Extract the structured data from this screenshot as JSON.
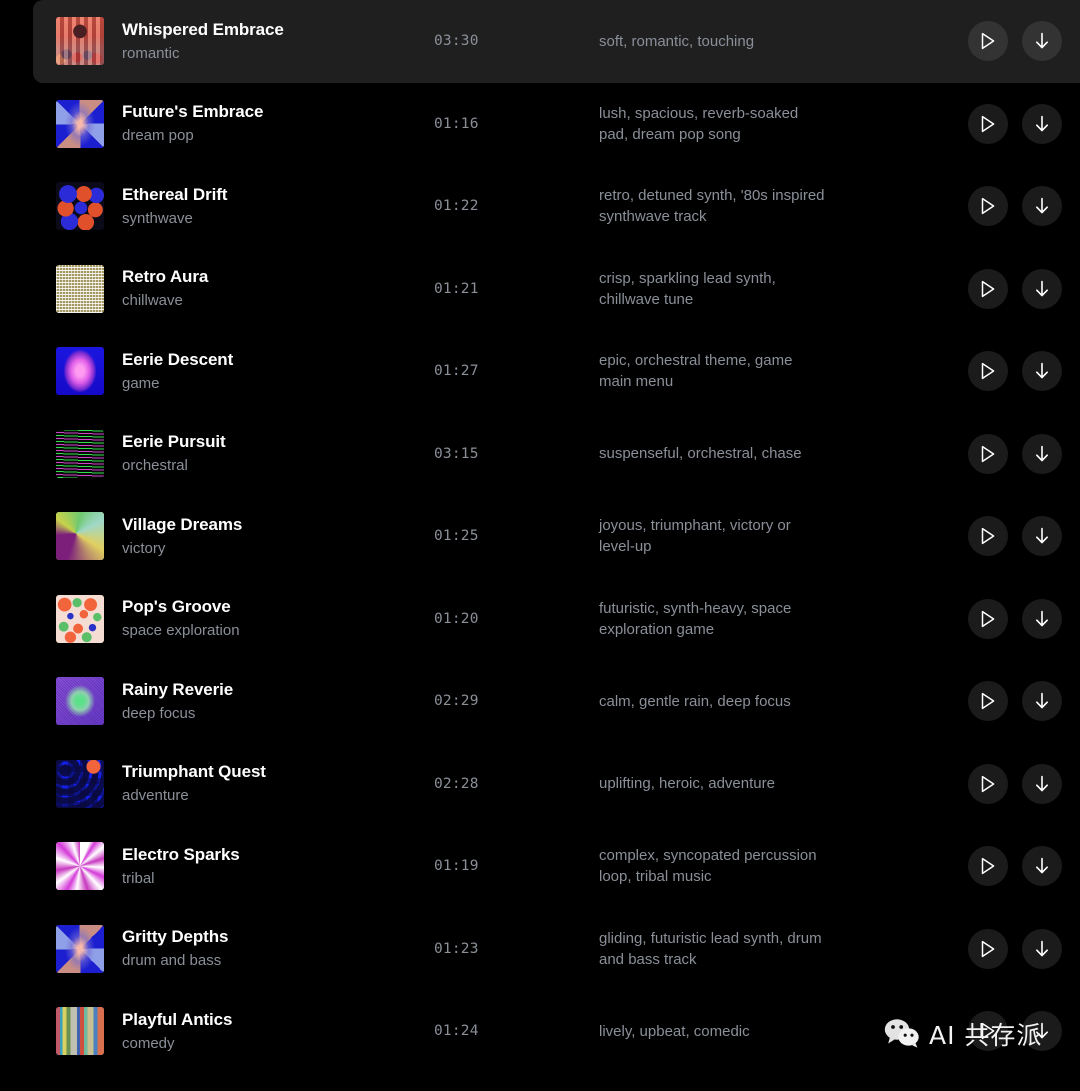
{
  "theme": {
    "background": "#000000",
    "selected_row_background": "#1f1f1f",
    "title_color": "#ffffff",
    "secondary_text_color": "#8a8f98",
    "button_background": "#1b1b1b",
    "button_background_selected": "#333333"
  },
  "actions": {
    "play_label": "play-icon",
    "download_label": "download-icon"
  },
  "watermark": {
    "icon": "wechat-icon",
    "text": "AI 共存派"
  },
  "tracks": [
    {
      "title": "Whispered Embrace",
      "genre": "romantic",
      "duration": "03:30",
      "tags": "soft, romantic, touching",
      "artwork": "art-crowd",
      "artwork_name": "pixel-crowd-red-hall",
      "selected": true
    },
    {
      "title": "Future's Embrace",
      "genre": "dream pop",
      "duration": "01:16",
      "tags": "lush, spacious, reverb-soaked pad, dream pop song",
      "artwork": "art-xblue",
      "artwork_name": "blue-x-starburst",
      "selected": false
    },
    {
      "title": "Ethereal Drift",
      "genre": "synthwave",
      "duration": "01:22",
      "tags": "retro, detuned synth, '80s inspired synthwave track",
      "artwork": "art-dots",
      "artwork_name": "blue-orange-dot-grid",
      "selected": false
    },
    {
      "title": "Retro Aura",
      "genre": "chillwave",
      "duration": "01:21",
      "tags": "crisp, sparkling lead synth, chillwave tune",
      "artwork": "art-weave",
      "artwork_name": "woven-gold-mesh",
      "selected": false
    },
    {
      "title": "Eerie Descent",
      "genre": "game",
      "duration": "01:27",
      "tags": "epic, orchestral theme, game main menu",
      "artwork": "art-diamond",
      "artwork_name": "pink-diamond-on-blue",
      "selected": false
    },
    {
      "title": "Eerie Pursuit",
      "genre": "orchestral",
      "duration": "03:15",
      "tags": "suspenseful, orchestral, chase",
      "artwork": "art-lines",
      "artwork_name": "green-magenta-scanlines",
      "selected": false
    },
    {
      "title": "Village Dreams",
      "genre": "victory",
      "duration": "01:25",
      "tags": "joyous, triumphant, victory or level-up",
      "artwork": "art-swirl",
      "artwork_name": "purple-green-swirl",
      "selected": false
    },
    {
      "title": "Pop's Groove",
      "genre": "space exploration",
      "duration": "01:20",
      "tags": "futuristic, synth-heavy, space exploration game",
      "artwork": "art-confetti",
      "artwork_name": "pastel-confetti-dots",
      "selected": false
    },
    {
      "title": "Rainy Reverie",
      "genre": "deep focus",
      "duration": "02:29",
      "tags": "calm, gentle rain, deep focus",
      "artwork": "art-rain",
      "artwork_name": "green-purple-halftone",
      "selected": false
    },
    {
      "title": "Triumphant Quest",
      "genre": "adventure",
      "duration": "02:28",
      "tags": "uplifting, heroic, adventure",
      "artwork": "art-grid",
      "artwork_name": "blue-dot-grid-orange-accent",
      "selected": false
    },
    {
      "title": "Electro Sparks",
      "genre": "tribal",
      "duration": "01:19",
      "tags": "complex, syncopated percussion loop, tribal music",
      "artwork": "art-burst",
      "artwork_name": "magenta-ray-burst",
      "selected": false
    },
    {
      "title": "Gritty Depths",
      "genre": "drum and bass",
      "duration": "01:23",
      "tags": "gliding, futuristic lead synth, drum and bass track",
      "artwork": "art-xblue",
      "artwork_name": "blue-x-starburst",
      "selected": false
    },
    {
      "title": "Playful Antics",
      "genre": "comedy",
      "duration": "01:24",
      "tags": "lively, upbeat, comedic",
      "artwork": "art-glitch",
      "artwork_name": "glitch-color-blocks",
      "selected": false
    }
  ]
}
